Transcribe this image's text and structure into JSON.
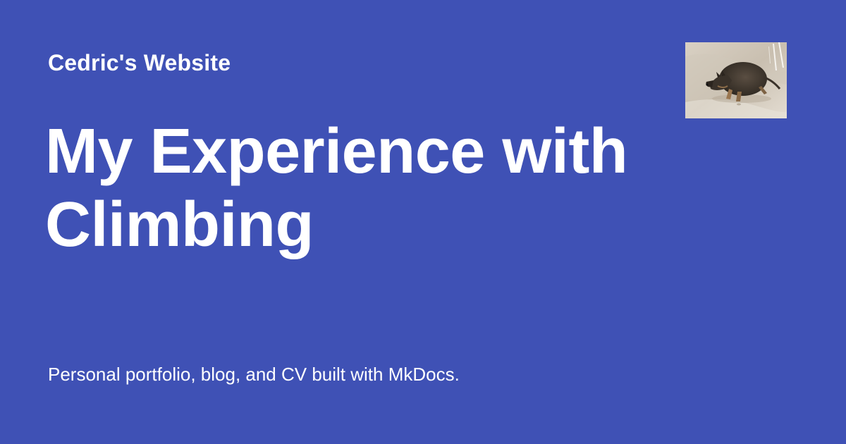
{
  "site": {
    "name": "Cedric's Website"
  },
  "page": {
    "title": "My Experience with Climbing",
    "description": "Personal portfolio, blog, and CV built with MkDocs."
  },
  "theme": {
    "background": "#3f51b5",
    "text_color": "#ffffff"
  },
  "logo": {
    "icon": "dog-photo-icon"
  }
}
